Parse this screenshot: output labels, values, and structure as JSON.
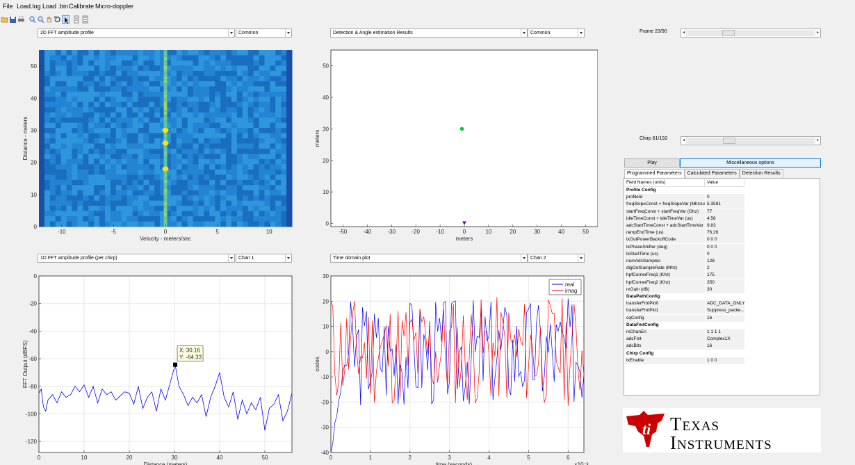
{
  "menu": [
    "File",
    "Load.log",
    "Load .bin",
    "Calibrate",
    "Micro-doppler"
  ],
  "toolbar_icons": [
    "open-icon",
    "save-icon",
    "print-icon",
    "zoom-in-icon",
    "zoom-out-icon",
    "pan-icon",
    "rotate-icon",
    "data-cursor-icon",
    "brush-icon",
    "legend-icon"
  ],
  "panels": {
    "tl": {
      "select": "2D FFT amplitude profile",
      "select2": "Common"
    },
    "tr": {
      "select": "Detection & Angle estimation Results",
      "select2": "Common"
    },
    "bl": {
      "select": "1D FFT amplitude profile (per chirp)",
      "select2": "Chan 1"
    },
    "br": {
      "select": "Time domain plot",
      "select2": "Chan 2"
    }
  },
  "frame": {
    "label": "Frame 23/90",
    "position": 0.3
  },
  "chirp": {
    "label": "Chirp 61/192",
    "position": 0.31
  },
  "buttons": {
    "play": "Play",
    "misc": "Miscellaneous options"
  },
  "tabs": [
    "Programmed Parameters",
    "Calculated Parameters",
    "Detection Results"
  ],
  "table": {
    "header": {
      "field": "Field Names   (units)",
      "value": "Value"
    },
    "rows": [
      {
        "f": "Profile Config",
        "v": "",
        "section": true
      },
      {
        "f": "profileId",
        "v": "0"
      },
      {
        "f": "freqSlopeConst + freqSlopeVar (Mhz/us)",
        "v": "5.3591"
      },
      {
        "f": "startFreqConst + startFreqVar (Ghz)",
        "v": "77"
      },
      {
        "f": "idleTimeConst + idleTimeVar (us)",
        "v": "4.58"
      },
      {
        "f": "adcStartTimeConst + adcStartTimeVar ...",
        "v": "9.83"
      },
      {
        "f": "rampEndTime (us)",
        "v": "76.26"
      },
      {
        "f": "txOutPowerBackoffCode",
        "v": "0 0 0"
      },
      {
        "f": "txPhaseShifter (deg)",
        "v": "0 0 0"
      },
      {
        "f": "txStartTime (us)",
        "v": "0"
      },
      {
        "f": "numAdcSamples",
        "v": "128"
      },
      {
        "f": "digOutSampleRate (Mhz)",
        "v": "2"
      },
      {
        "f": "hpfCornerFreq1 (Khz)",
        "v": "175"
      },
      {
        "f": "hpfCornerFreq2 (Khz)",
        "v": "350"
      },
      {
        "f": "rxGain (dB)",
        "v": "30"
      },
      {
        "f": "DataPathConfig",
        "v": "",
        "section": true
      },
      {
        "f": "transferFmtPkt0",
        "v": "ADC_DATA_ONLY"
      },
      {
        "f": "transferFmtPkt1",
        "v": "Suppress_packe..."
      },
      {
        "f": "cqConfig",
        "v": "16"
      },
      {
        "f": "DataFmtConfig",
        "v": "",
        "section": true
      },
      {
        "f": "rxChanEn",
        "v": "1 1 1 1"
      },
      {
        "f": "adcFmt",
        "v": "Complex1X"
      },
      {
        "f": "adcBits",
        "v": "16"
      },
      {
        "f": "Chirp Config",
        "v": "",
        "section": true
      },
      {
        "f": "txEnable",
        "v": "1 0 0"
      }
    ]
  },
  "logo": {
    "line1": "Texas",
    "line2": "Instruments"
  },
  "colors": {
    "accent_blue": "#0000ff",
    "accent_red": "#ff0000",
    "ti_red": "#cc0000",
    "highlight_blue": "#e5f1fb"
  },
  "chart_data": [
    {
      "type": "heatmap",
      "xlabel": "Velocity - meters/sec",
      "ylabel": "Distance - meters",
      "xticks": [
        -10,
        -5,
        0,
        5,
        10
      ],
      "yticks": [
        0,
        10,
        20,
        30,
        40,
        50
      ],
      "xlim": [
        -12.2,
        12.2
      ],
      "ylim": [
        0,
        55
      ],
      "hot_cells": [
        {
          "x": 0,
          "y": 30
        },
        {
          "x": 0,
          "y": 26
        },
        {
          "x": 0,
          "y": 18
        }
      ]
    },
    {
      "type": "scatter",
      "xlabel": "meters",
      "ylabel": "meters",
      "xticks": [
        -50,
        -40,
        -30,
        -20,
        -10,
        0,
        10,
        20,
        30,
        40,
        50
      ],
      "yticks": [
        0,
        10,
        20,
        30,
        40,
        50
      ],
      "xlim": [
        -55,
        55
      ],
      "ylim": [
        -1,
        55
      ],
      "points": [
        {
          "x": -1,
          "y": 30,
          "color": "#00cc33"
        }
      ],
      "markers": [
        {
          "x": 0,
          "y": 0,
          "color": "#5a0a9a",
          "shape": "triangle-down"
        }
      ]
    },
    {
      "type": "line",
      "xlabel": "Distance (meters)",
      "ylabel": "FFT Output (dBFS)",
      "xticks": [
        0,
        10,
        20,
        30,
        40,
        50
      ],
      "yticks": [
        0,
        -20,
        -40,
        -60,
        -80,
        -100,
        -120
      ],
      "xlim": [
        0,
        56
      ],
      "ylim": [
        -128,
        0
      ],
      "datatip": {
        "x": 30.16,
        "y": -64.33,
        "xlabel": "X: 30.16",
        "ylabel": "Y: -64.33"
      },
      "series": [
        {
          "color": "#0000ff",
          "x": [
            0,
            0.5,
            1,
            1.5,
            2,
            3,
            4,
            5,
            6,
            7,
            8,
            9,
            10,
            11,
            12,
            13,
            14,
            15,
            16,
            17,
            18,
            19,
            20,
            21,
            22,
            23,
            24,
            25,
            26,
            27,
            28,
            29,
            29.5,
            30.16,
            31,
            32,
            33,
            34,
            35,
            36,
            37,
            38,
            39,
            40,
            41,
            42,
            43,
            44,
            45,
            46,
            47,
            48,
            49,
            50,
            51,
            52,
            53,
            54,
            55,
            56
          ],
          "y": [
            -85,
            -82,
            -95,
            -98,
            -90,
            -86,
            -92,
            -84,
            -88,
            -86,
            -80,
            -84,
            -79,
            -88,
            -80,
            -92,
            -82,
            -86,
            -84,
            -90,
            -87,
            -84,
            -85,
            -93,
            -80,
            -96,
            -88,
            -84,
            -98,
            -82,
            -90,
            -78,
            -72,
            -64.33,
            -80,
            -86,
            -94,
            -88,
            -92,
            -86,
            -102,
            -88,
            -80,
            -70,
            -88,
            -95,
            -84,
            -104,
            -90,
            -100,
            -92,
            -97,
            -88,
            -112,
            -96,
            -93,
            -86,
            -105,
            -98,
            -85
          ]
        }
      ]
    },
    {
      "type": "line",
      "xlabel": "time (seconds) →",
      "ylabel": "codes",
      "exponent": "×10⁻³",
      "xticks": [
        0,
        1,
        2,
        3,
        4,
        5,
        6
      ],
      "yticks": [
        30,
        20,
        10,
        0,
        -10,
        -20,
        -30,
        -40
      ],
      "xlim": [
        0,
        6.4
      ],
      "ylim": [
        -40,
        30
      ],
      "legend": {
        "position": "top-right"
      },
      "series": [
        {
          "name": "real",
          "color": "#0000ff",
          "seed": 3,
          "start": -40
        },
        {
          "name": "imag",
          "color": "#ff0000",
          "seed": 11,
          "start": 20
        }
      ]
    }
  ]
}
